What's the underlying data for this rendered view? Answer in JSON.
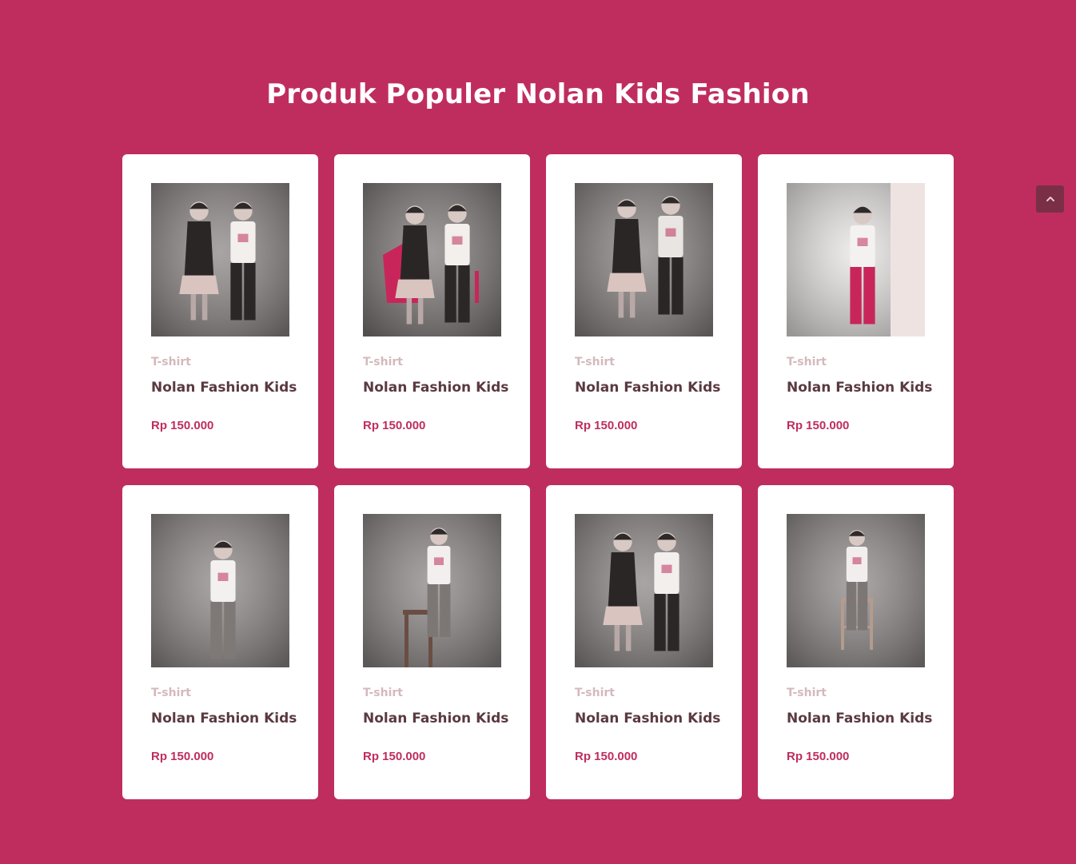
{
  "section": {
    "title": "Produk Populer Nolan Kids Fashion"
  },
  "colors": {
    "background": "#bf2d5e",
    "card": "#ffffff",
    "price": "#bf2d5e",
    "category": "#d4b9bd",
    "title": "#5a3a40"
  },
  "products": [
    {
      "category": "T-shirt",
      "title": "Nolan Fashion Kids",
      "price": "Rp 150.000",
      "photo": "two-kids-arms-crossed"
    },
    {
      "category": "T-shirt",
      "title": "Nolan Fashion Kids",
      "price": "Rp 150.000",
      "photo": "two-kids-pink-jacket"
    },
    {
      "category": "T-shirt",
      "title": "Nolan Fashion Kids",
      "price": "Rp 150.000",
      "photo": "two-kids-striped"
    },
    {
      "category": "T-shirt",
      "title": "Nolan Fashion Kids",
      "price": "Rp 150.000",
      "photo": "boy-pink-pants"
    },
    {
      "category": "T-shirt",
      "title": "Nolan Fashion Kids",
      "price": "Rp 150.000",
      "photo": "boy-standing"
    },
    {
      "category": "T-shirt",
      "title": "Nolan Fashion Kids",
      "price": "Rp 150.000",
      "photo": "boy-on-stool"
    },
    {
      "category": "T-shirt",
      "title": "Nolan Fashion Kids",
      "price": "Rp 150.000",
      "photo": "two-kids-arms-crossed"
    },
    {
      "category": "T-shirt",
      "title": "Nolan Fashion Kids",
      "price": "Rp 150.000",
      "photo": "boy-sitting-stool"
    }
  ],
  "scroll_top": {
    "icon": "chevron-up-icon"
  }
}
